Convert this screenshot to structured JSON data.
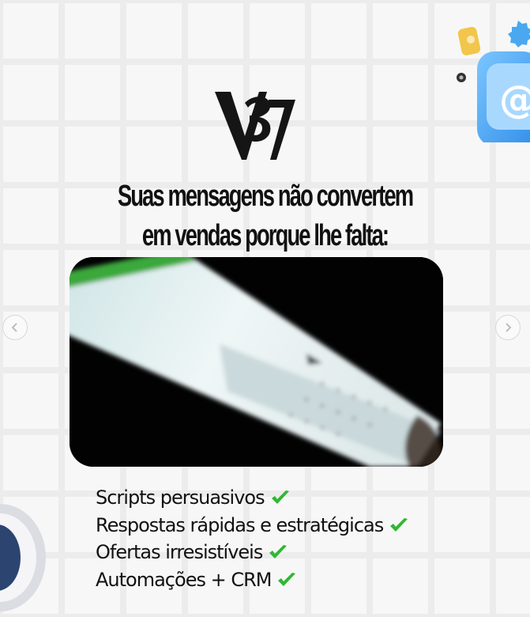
{
  "logo": {
    "text": "V3V"
  },
  "headline": {
    "line1": "Suas mensagens não convertem",
    "line2": "em vendas porque lhe falta:"
  },
  "carousel": {
    "prev_icon": "chevron-left-icon",
    "next_icon": "chevron-right-icon"
  },
  "benefits": [
    {
      "label": "Scripts persuasivos",
      "icon": "check-icon"
    },
    {
      "label": "Respostas rápidas e estratégicas",
      "icon": "check-icon"
    },
    {
      "label": "Ofertas irresistíveis",
      "icon": "check-icon"
    },
    {
      "label": "Automações + CRM",
      "icon": "check-icon"
    }
  ],
  "colors": {
    "check": "#2fb830",
    "text": "#111111",
    "mail_tile": "#48a8f5",
    "phone_screen": "#e7f1f2"
  }
}
